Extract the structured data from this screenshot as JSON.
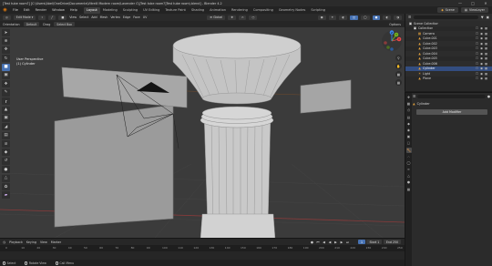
{
  "window": {
    "title": "[Test tube room?] [C:\\Users\\Abel\\OneDrive\\Documents\\Vitreill Modern room\\Lavender C\\[Test tube room?]Test tube room\\.blend] - Blender 4.2"
  },
  "menubar": {
    "items": [
      "File",
      "Edit",
      "Render",
      "Window",
      "Help"
    ],
    "workspaces": [
      "Layout",
      "Modeling",
      "Sculpting",
      "UV Editing",
      "Texture Paint",
      "Shading",
      "Animation",
      "Rendering",
      "Compositing",
      "Geometry Nodes",
      "Scripting"
    ],
    "active_workspace": "Layout",
    "scene_label": "Scene",
    "view_layer_label": "ViewLayer"
  },
  "viewport_header": {
    "mode": "Edit Mode",
    "menus": [
      "View",
      "Select",
      "Add",
      "Mesh",
      "Vertex",
      "Edge",
      "Face",
      "UV"
    ],
    "transform_orientation": "Global",
    "orientation_label": "Orientation",
    "orientation_value": "Default",
    "drag_label": "Drag",
    "drag_value": "Select Box",
    "options_label": "Options"
  },
  "viewport": {
    "view_name": "User Perspective",
    "object_name": "(1) Cylinder"
  },
  "gizmo": {
    "x_label": "X",
    "y_label": "Y",
    "z_label": "Z"
  },
  "outliner": {
    "search_placeholder": "",
    "rows": [
      {
        "label": "Scene Collection",
        "icon": "collection-icon",
        "indent": 0,
        "selected": false
      },
      {
        "label": "Collection",
        "icon": "collection-icon",
        "indent": 1,
        "selected": false
      },
      {
        "label": "Camera",
        "icon": "camera-icon",
        "indent": 2,
        "selected": false
      },
      {
        "label": "Cube.001",
        "icon": "mesh-icon",
        "indent": 2,
        "selected": false
      },
      {
        "label": "Cube.002",
        "icon": "mesh-icon",
        "indent": 2,
        "selected": false
      },
      {
        "label": "Cube.003",
        "icon": "mesh-icon",
        "indent": 2,
        "selected": false
      },
      {
        "label": "Cube.004",
        "icon": "mesh-icon",
        "indent": 2,
        "selected": false
      },
      {
        "label": "Cube.005",
        "icon": "mesh-icon",
        "indent": 2,
        "selected": false
      },
      {
        "label": "Cube.006",
        "icon": "mesh-icon",
        "indent": 2,
        "selected": false
      },
      {
        "label": "Cylinder",
        "icon": "mesh-icon",
        "indent": 2,
        "selected": true
      },
      {
        "label": "Light",
        "icon": "light-icon",
        "indent": 2,
        "selected": false
      },
      {
        "label": "Plane",
        "icon": "mesh-icon",
        "indent": 2,
        "selected": false
      }
    ]
  },
  "properties": {
    "object_name": "Cylinder",
    "add_modifier_label": "Add Modifier"
  },
  "timeline": {
    "menus": [
      "Playback",
      "Keying",
      "View",
      "Marker"
    ],
    "current_frame": "1",
    "start_label": "Start",
    "start_value": "1",
    "end_label": "End",
    "end_value": "250",
    "ticks": [
      "0",
      "10",
      "20",
      "30",
      "40",
      "50",
      "60",
      "70",
      "80",
      "90",
      "100",
      "110",
      "120",
      "130",
      "140",
      "150",
      "160",
      "170",
      "180",
      "190",
      "200",
      "210",
      "220",
      "230",
      "240",
      "250"
    ]
  },
  "statusbar": {
    "items": [
      "Select",
      "Rotate View",
      "Call Menu"
    ]
  },
  "colors": {
    "accent": "#4772b3",
    "selected_row": "#334d80",
    "x_axis": "#e8494a",
    "y_axis": "#76b41f",
    "z_axis": "#3d83e6",
    "blender_orange": "#e87d0d"
  }
}
